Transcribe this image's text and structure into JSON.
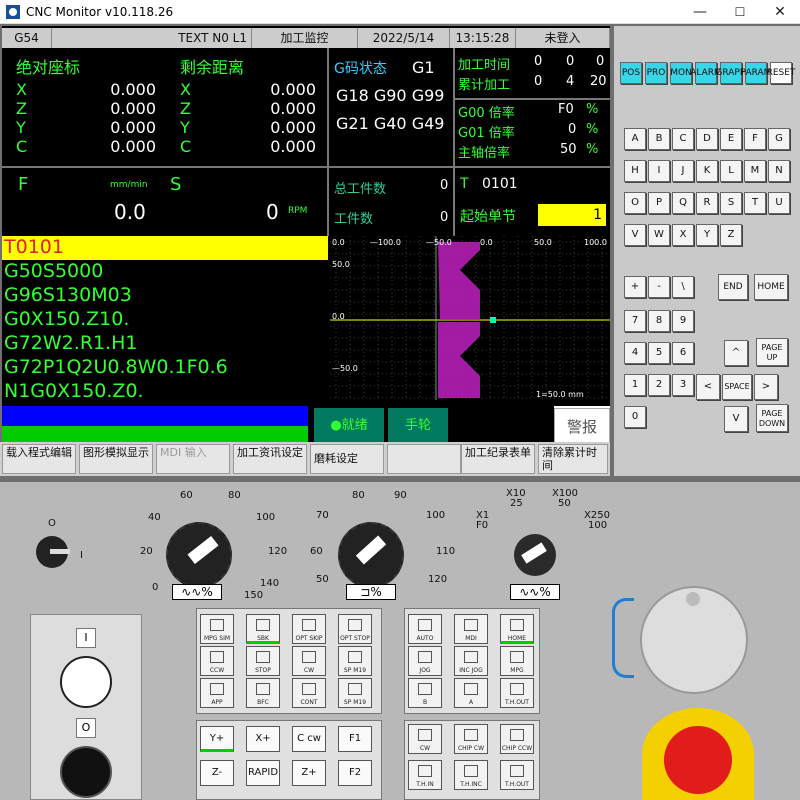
{
  "window": {
    "title": "CNC Monitor v10.118.26",
    "minimize": "—",
    "maximize": "☐",
    "close": "✕"
  },
  "header": {
    "coord_sys": "G54",
    "program": "TEXT N0 L1",
    "mode": "加工监控",
    "date": "2022/5/14",
    "time": "13:15:28",
    "login": "未登入"
  },
  "coords": {
    "abs_title": "绝对座标",
    "rem_title": "剩余距离",
    "abs": [
      {
        "axis": "X",
        "value": "0.000"
      },
      {
        "axis": "Z",
        "value": "0.000"
      },
      {
        "axis": "Y",
        "value": "0.000"
      },
      {
        "axis": "C",
        "value": "0.000"
      }
    ],
    "rem": [
      {
        "axis": "X",
        "value": "0.000"
      },
      {
        "axis": "Z",
        "value": "0.000"
      },
      {
        "axis": "Y",
        "value": "0.000"
      },
      {
        "axis": "C",
        "value": "0.000"
      }
    ]
  },
  "gcode": {
    "title": "G码状态",
    "g1": "G1",
    "line1": "G18 G90 G99",
    "line2": "G21 G40 G49"
  },
  "machining": {
    "time_label": "加工时间",
    "time_vals": [
      "0",
      "0",
      "0"
    ],
    "total_label": "累计加工",
    "total_vals": [
      "0",
      "4",
      "20"
    ],
    "g00_label": "G00 倍率",
    "g00_val": "F0",
    "g00_unit": "%",
    "g01_label": "G01 倍率",
    "g01_val": "0",
    "g01_unit": "%",
    "spindle_label": "主轴倍率",
    "spindle_val": "50",
    "spindle_unit": "%"
  },
  "feed": {
    "f_label": "F",
    "f_unit": "mm/min",
    "f_val": "0.0",
    "s_label": "S",
    "s_val": "0",
    "s_unit": "RPM"
  },
  "counts": {
    "total_label": "总工件数",
    "total_val": "0",
    "part_label": "工件数",
    "part_val": "0",
    "tool_label": "T",
    "tool_val": "0101",
    "start_label": "起始单节",
    "start_val": "1"
  },
  "program_lines": [
    "T0101",
    "G50S5000",
    "G96S130M03",
    "G0X150.Z10.",
    "G72W2.R1.H1",
    "G72P1Q2U0.8W0.1F0.6",
    "N1G0X150.Z0."
  ],
  "graph": {
    "x_ticks": [
      "0.0",
      "—100.0",
      "—50.0",
      "0.0",
      "50.0",
      "100.0"
    ],
    "y_ticks": [
      "50.0",
      "0.0",
      "—50.0"
    ],
    "scale": "1=50.0 mm"
  },
  "status": {
    "ready": "●就绪",
    "handwheel": "手轮",
    "alarm": "警报"
  },
  "softkeys": [
    "载入程式编辑",
    "图形模拟显示",
    "MDI 输入",
    "加工资讯设定",
    "磨耗设定",
    "",
    "加工纪录表单",
    "清除累计时间"
  ],
  "keypad": {
    "func": [
      "POS",
      "PRO",
      "MON",
      "ALARM",
      "GRAPH",
      "PARAM",
      "RESET"
    ],
    "letters": [
      "A",
      "B",
      "C",
      "D",
      "E",
      "F",
      "G",
      "H",
      "I",
      "J",
      "K",
      "L",
      "M",
      "N",
      "O",
      "P",
      "Q",
      "R",
      "S",
      "T",
      "U",
      "V",
      "W",
      "X",
      "Y",
      "Z"
    ],
    "symbols": [
      "+",
      "-",
      "\\"
    ],
    "digits": [
      "7",
      "8",
      "9",
      "4",
      "5",
      "6",
      "1",
      "2",
      "3",
      "0"
    ],
    "end": "END",
    "home": "HOME",
    "pageup": "PAGE UP",
    "pagedown": "PAGE DOWN",
    "space": "SPACE",
    "up": "^",
    "down": "V",
    "left": "<",
    "right": ">"
  },
  "dials": {
    "feed": [
      "0",
      "20",
      "40",
      "60",
      "80",
      "100",
      "120",
      "140",
      "150"
    ],
    "feed_ind": "∿∿%",
    "spindle": [
      "50",
      "60",
      "70",
      "80",
      "90",
      "100",
      "110",
      "120"
    ],
    "spindle_ind": "⊐%",
    "mpg": [
      "X1",
      "F0",
      "X10",
      "25",
      "X100",
      "50",
      "X250",
      "100"
    ],
    "mpg_ind": "∿∿%",
    "switch": [
      "O",
      "I"
    ]
  },
  "panel_buttons": {
    "left": [
      "MPG SIM",
      "SBK",
      "OPT SKIP",
      "OPT STOP",
      "CCW",
      "STOP",
      "CW",
      "SP M19",
      "APP",
      "BFC",
      "CONT",
      "SP M19"
    ],
    "right": [
      "AUTO",
      "MDI",
      "HOME",
      "JOG",
      "INC JOG",
      "MPG",
      "B",
      "A",
      "T.H.OUT"
    ],
    "axis": [
      "Y+",
      "X+",
      "C cw",
      "F1",
      "Z-",
      "RAPID",
      "Z+",
      "F2"
    ],
    "bottom_right": [
      "CW",
      "CHIP CW",
      "CHIP CCW",
      "T.H.IN",
      "T.H.INC",
      "T.H.OUT"
    ]
  },
  "power": {
    "on": "I",
    "off": "O"
  }
}
